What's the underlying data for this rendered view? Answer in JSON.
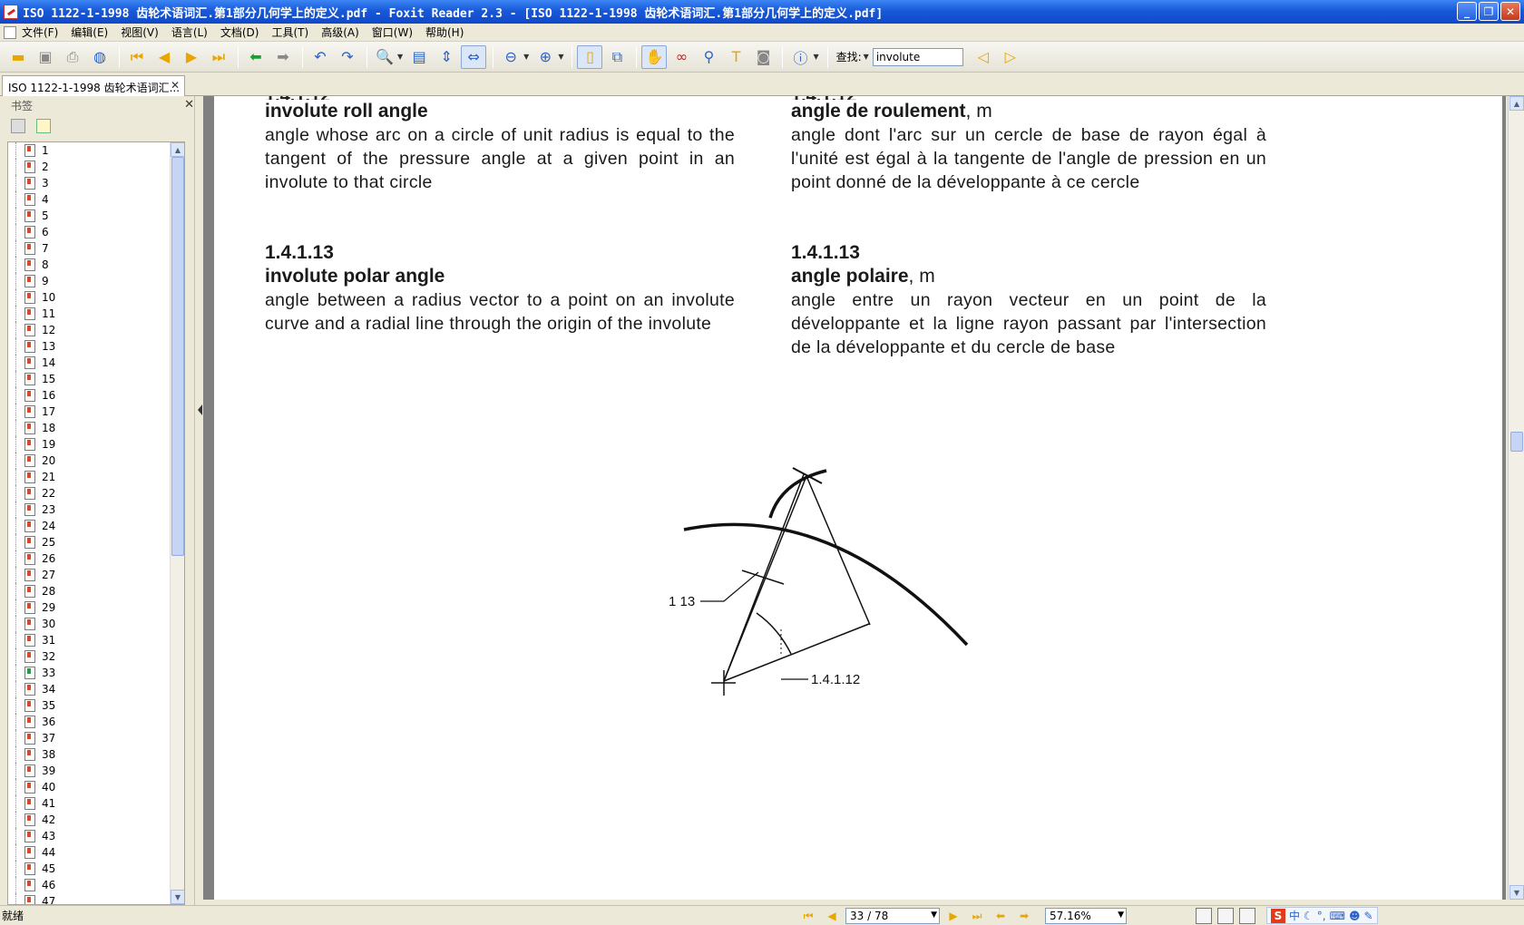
{
  "window": {
    "title": "ISO 1122-1-1998 齿轮术语词汇.第1部分几何学上的定义.pdf - Foxit Reader 2.3 - [ISO 1122-1-1998 齿轮术语词汇.第1部分几何学上的定义.pdf]",
    "minimize": "_",
    "restore": "❐",
    "close": "✕"
  },
  "menu": {
    "items": [
      "文件(F)",
      "编辑(E)",
      "视图(V)",
      "语言(L)",
      "文档(D)",
      "工具(T)",
      "高级(A)",
      "窗口(W)",
      "帮助(H)"
    ]
  },
  "toolbar": {
    "find_label": "查找:",
    "find_value": "involute"
  },
  "tab": {
    "label": "ISO 1122-1-1998 齿轮术语词汇...",
    "close": "✕"
  },
  "bookmarks": {
    "title": "书签",
    "close": "✕",
    "items": [
      "1",
      "2",
      "3",
      "4",
      "5",
      "6",
      "7",
      "8",
      "9",
      "10",
      "11",
      "12",
      "13",
      "14",
      "15",
      "16",
      "17",
      "18",
      "19",
      "20",
      "21",
      "22",
      "23",
      "24",
      "25",
      "26",
      "27",
      "28",
      "29",
      "30",
      "31",
      "32",
      "33",
      "34",
      "35",
      "36",
      "37",
      "38",
      "39",
      "40",
      "41",
      "42",
      "43",
      "44",
      "45",
      "46",
      "47"
    ],
    "active_item": "33"
  },
  "document": {
    "en_entry1": {
      "term": "involute roll angle",
      "definition": "angle whose arc on a circle of unit radius is equal to the tangent of the pressure angle at a given point in an involute to that circle"
    },
    "fr_entry1": {
      "term": "angle de roulement",
      "gender": ", m",
      "definition": "angle dont l'arc sur un cercle de base de rayon égal à l'unité est égal à la tangente de l'angle de pression en un point donné de la développante à ce cercle"
    },
    "en_entry2": {
      "number": "1.4.1.13",
      "term": "involute polar angle",
      "definition": "angle between a radius vector to a point on an involute curve and a radial line through the origin of the involute"
    },
    "fr_entry2": {
      "number": "1.4.1.13",
      "term": "angle polaire",
      "gender": ", m",
      "definition": "angle entre un rayon vecteur en un point de la développante et la ligne rayon passant par l'intersection de la développante et du cercle de base"
    },
    "figure": {
      "label_left": "1.4 1 13",
      "label_right": "1.4.1.12"
    }
  },
  "status": {
    "text": "就绪",
    "page": "33 / 78",
    "zoom": "57.16%",
    "ime_lang": "中"
  }
}
